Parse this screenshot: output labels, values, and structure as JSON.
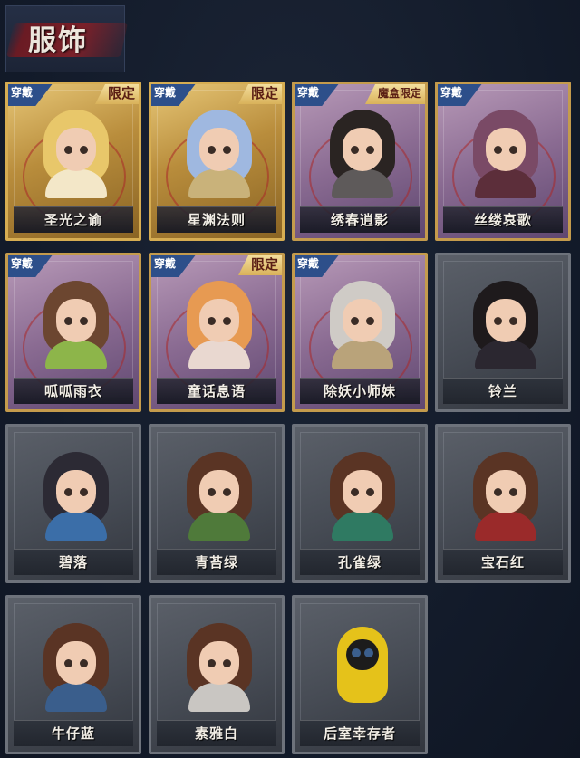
{
  "header": {
    "title": "服饰"
  },
  "tags": {
    "wear": "穿戴"
  },
  "skins": [
    {
      "name": "圣光之谕",
      "rarity": "gold",
      "worn": true,
      "limited": "限定",
      "hair": "#e8c76a",
      "body": "#f3e7c8"
    },
    {
      "name": "星渊法则",
      "rarity": "gold",
      "worn": true,
      "limited": "限定",
      "hair": "#9fb8e0",
      "body": "#c9b27a"
    },
    {
      "name": "绣春逍影",
      "rarity": "purple",
      "worn": true,
      "limited": "魔盒限定",
      "hair": "#2a2422",
      "body": "#5e5a5a"
    },
    {
      "name": "丝缕哀歌",
      "rarity": "purple",
      "worn": true,
      "limited": "",
      "hair": "#7a4a66",
      "body": "#5c2e3a"
    },
    {
      "name": "呱呱雨衣",
      "rarity": "purple",
      "worn": true,
      "limited": "",
      "hair": "#6c4630",
      "body": "#8db54a"
    },
    {
      "name": "童话息语",
      "rarity": "purple",
      "worn": true,
      "limited": "限定",
      "hair": "#e79a52",
      "body": "#e9d8d0"
    },
    {
      "name": "除妖小师妹",
      "rarity": "purple",
      "worn": true,
      "limited": "",
      "hair": "#cfcbc6",
      "body": "#b9a37a"
    },
    {
      "name": "铃兰",
      "rarity": "gray",
      "worn": false,
      "limited": "",
      "hair": "#1e1a1c",
      "body": "#2b2730"
    },
    {
      "name": "碧落",
      "rarity": "gray",
      "worn": false,
      "limited": "",
      "hair": "#2c2a34",
      "body": "#3b6ea8"
    },
    {
      "name": "青苔绿",
      "rarity": "gray",
      "worn": false,
      "limited": "",
      "hair": "#5a3424",
      "body": "#4f7a3a"
    },
    {
      "name": "孔雀绿",
      "rarity": "gray",
      "worn": false,
      "limited": "",
      "hair": "#5a3424",
      "body": "#2f7a62"
    },
    {
      "name": "宝石红",
      "rarity": "gray",
      "worn": false,
      "limited": "",
      "hair": "#5a3424",
      "body": "#9a2a2a"
    },
    {
      "name": "牛仔蓝",
      "rarity": "gray",
      "worn": false,
      "limited": "",
      "hair": "#5a3424",
      "body": "#3a5e8c"
    },
    {
      "name": "素雅白",
      "rarity": "gray",
      "worn": false,
      "limited": "",
      "hair": "#5a3424",
      "body": "#c9c6c2"
    },
    {
      "name": "后室幸存者",
      "rarity": "gray",
      "worn": false,
      "limited": "",
      "hair": "#e5c21a",
      "body": "#e5c21a",
      "hazmat": true
    }
  ]
}
